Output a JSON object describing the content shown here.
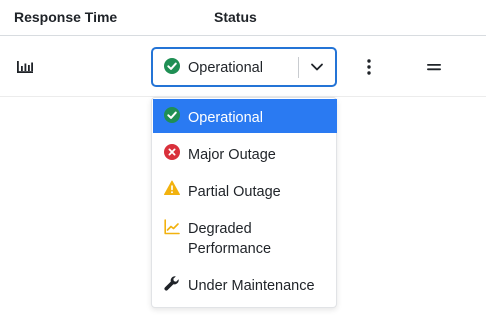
{
  "columns": {
    "response_time": "Response Time",
    "status": "Status"
  },
  "row": {
    "response_icon": "bar-chart-icon",
    "status_value": "Operational",
    "status_icon": "check-circle-icon",
    "actions_icon": "kebab-icon",
    "reorder_icon": "drag-handle-icon"
  },
  "dropdown": {
    "options": [
      {
        "label": "Operational",
        "icon": "check-circle-icon",
        "color": "#1f8f54",
        "selected": true
      },
      {
        "label": "Major Outage",
        "icon": "x-circle-icon",
        "color": "#d9303b",
        "selected": false
      },
      {
        "label": "Partial Outage",
        "icon": "warning-icon",
        "color": "#f2b20f",
        "selected": false
      },
      {
        "label_line1": "Degraded",
        "label_line2": "Performance",
        "icon": "trend-chart-icon",
        "color": "#f2b20f",
        "selected": false
      },
      {
        "label": "Under Maintenance",
        "icon": "wrench-icon",
        "color": "#1f2328",
        "selected": false
      }
    ]
  },
  "colors": {
    "accent": "#2a7af2",
    "focus_border": "#2474d6",
    "operational": "#1f8f54",
    "major_outage": "#d9303b",
    "partial_outage": "#f2b20f"
  }
}
